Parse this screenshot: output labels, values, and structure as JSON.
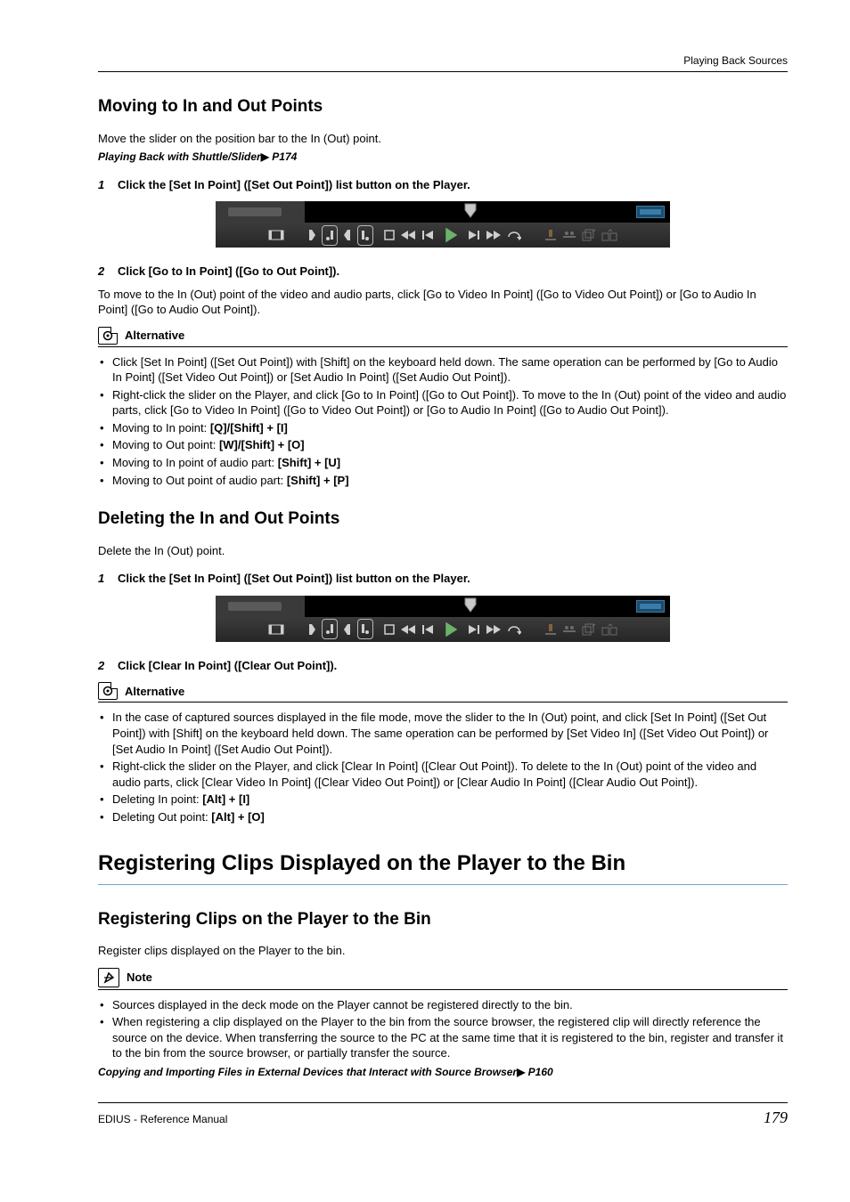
{
  "header": {
    "breadcrumb": "Playing Back Sources"
  },
  "sec1": {
    "title": "Moving to In and Out Points",
    "intro": "Move the slider on the position bar to the In (Out) point.",
    "link": "Playing Back with Shuttle/Slider",
    "linkPage": " P174",
    "step1": "Click the [Set In Point] ([Set Out Point]) list button on the Player.",
    "step2": "Click [Go to In Point] ([Go to Out Point]).",
    "after2": "To move to the In (Out) point of the video and audio parts, click [Go to Video In Point] ([Go to Video Out Point]) or [Go to Audio In Point] ([Go to Audio Out Point]).",
    "altTitle": "Alternative",
    "alt": [
      "Click [Set In Point] ([Set Out Point]) with [Shift] on the keyboard held down. The same operation can be performed by [Go to Audio In Point] ([Set Video Out Point]) or [Set Audio In Point] ([Set Audio Out Point]).",
      "Right-click the slider on the Player, and click [Go to In Point] ([Go to Out Point]). To move to the In (Out) point of the video and audio parts, click [Go to Video In Point] ([Go to Video Out Point]) or [Go to Audio In Point] ([Go to Audio Out Point])."
    ],
    "kb": [
      {
        "pre": "Moving to In point: ",
        "keys": "[Q]/[Shift] + [I]"
      },
      {
        "pre": "Moving to Out point: ",
        "keys": "[W]/[Shift] + [O]"
      },
      {
        "pre": "Moving to In point of audio part: ",
        "keys": "[Shift] + [U]"
      },
      {
        "pre": "Moving to Out point of audio part: ",
        "keys": "[Shift] + [P]"
      }
    ]
  },
  "sec2": {
    "title": "Deleting the In and Out Points",
    "intro": "Delete the In (Out) point.",
    "step1": "Click the [Set In Point] ([Set Out Point]) list button on the Player.",
    "step2": "Click [Clear In Point] ([Clear Out Point]).",
    "altTitle": "Alternative",
    "alt": [
      "In the case of captured sources displayed in the file mode, move the slider to the In (Out) point, and click [Set In Point] ([Set Out Point]) with [Shift] on the keyboard held down. The same operation can be performed by [Set Video In] ([Set Video Out Point]) or [Set Audio In Point] ([Set Audio Out Point]).",
      "Right-click the slider on the Player, and click [Clear In Point] ([Clear Out Point]). To delete to the In (Out) point of the video and audio parts, click [Clear Video In Point] ([Clear Video Out Point]) or [Clear Audio In Point] ([Clear Audio Out Point])."
    ],
    "kb": [
      {
        "pre": "Deleting In point: ",
        "keys": "[Alt] + [I]"
      },
      {
        "pre": "Deleting Out point: ",
        "keys": "[Alt] + [O]"
      }
    ]
  },
  "sec3": {
    "h1": "Registering Clips Displayed on the Player to the Bin",
    "title": "Registering Clips on the Player to the Bin",
    "intro": "Register clips displayed on the Player to the bin.",
    "noteTitle": "Note",
    "notes": [
      "Sources displayed in the deck mode on the Player cannot be registered directly to the bin.",
      "When registering a clip displayed on the Player to the bin from the source browser, the registered clip will directly reference the source on the device. When transferring the source to the PC at the same time that it is registered to the bin, register and transfer it to the bin from the source browser, or partially transfer the source."
    ],
    "link": "Copying and Importing Files in External Devices that Interact with Source Browser",
    "linkPage": " P160"
  },
  "footer": {
    "left": "EDIUS - Reference Manual",
    "page": "179"
  }
}
